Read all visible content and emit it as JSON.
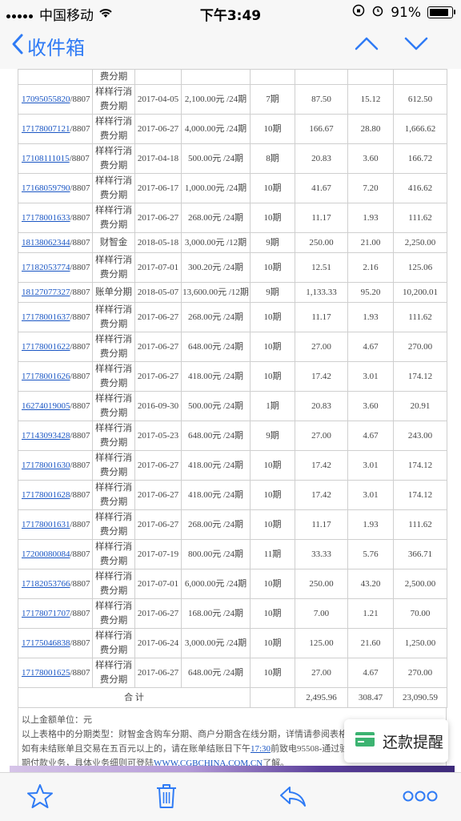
{
  "status_bar": {
    "carrier": "中国移动",
    "time": "下午3:49",
    "battery": "91%"
  },
  "nav": {
    "back_label": "收件箱"
  },
  "rows": [
    {
      "id": "17095055820",
      "suffix": "/8807",
      "type_a": "样样行消",
      "type_b": "费分期",
      "date": "2017-04-05",
      "amount": "2,100.00元 /24期",
      "period": "7期",
      "principal": "87.50",
      "fee": "15.12",
      "remaining": "612.50"
    },
    {
      "id": "17178007121",
      "suffix": "/8807",
      "type_a": "样样行消",
      "type_b": "费分期",
      "date": "2017-06-27",
      "amount": "4,000.00元 /24期",
      "period": "10期",
      "principal": "166.67",
      "fee": "28.80",
      "remaining": "1,666.62"
    },
    {
      "id": "17108111015",
      "suffix": "/8807",
      "type_a": "样样行消",
      "type_b": "费分期",
      "date": "2017-04-18",
      "amount": "500.00元 /24期",
      "period": "8期",
      "principal": "20.83",
      "fee": "3.60",
      "remaining": "166.72"
    },
    {
      "id": "17168059790",
      "suffix": "/8807",
      "type_a": "样样行消",
      "type_b": "费分期",
      "date": "2017-06-17",
      "amount": "1,000.00元 /24期",
      "period": "10期",
      "principal": "41.67",
      "fee": "7.20",
      "remaining": "416.62"
    },
    {
      "id": "17178001633",
      "suffix": "/8807",
      "type_a": "样样行消",
      "type_b": "费分期",
      "date": "2017-06-27",
      "amount": "268.00元 /24期",
      "period": "10期",
      "principal": "11.17",
      "fee": "1.93",
      "remaining": "111.62"
    },
    {
      "id": "18138062344",
      "suffix": "/8807",
      "type_a": "财智金",
      "type_b": "",
      "date": "2018-05-18",
      "amount": "3,000.00元 /12期",
      "period": "9期",
      "principal": "250.00",
      "fee": "21.00",
      "remaining": "2,250.00"
    },
    {
      "id": "17182053774",
      "suffix": "/8807",
      "type_a": "样样行消",
      "type_b": "费分期",
      "date": "2017-07-01",
      "amount": "300.20元 /24期",
      "period": "10期",
      "principal": "12.51",
      "fee": "2.16",
      "remaining": "125.06"
    },
    {
      "id": "18127077327",
      "suffix": "/8807",
      "type_a": "账单分期",
      "type_b": "",
      "date": "2018-05-07",
      "amount": "13,600.00元 /12期",
      "period": "9期",
      "principal": "1,133.33",
      "fee": "95.20",
      "remaining": "10,200.01"
    },
    {
      "id": "17178001637",
      "suffix": "/8807",
      "type_a": "样样行消",
      "type_b": "费分期",
      "date": "2017-06-27",
      "amount": "268.00元 /24期",
      "period": "10期",
      "principal": "11.17",
      "fee": "1.93",
      "remaining": "111.62"
    },
    {
      "id": "17178001622",
      "suffix": "/8807",
      "type_a": "样样行消",
      "type_b": "费分期",
      "date": "2017-06-27",
      "amount": "648.00元 /24期",
      "period": "10期",
      "principal": "27.00",
      "fee": "4.67",
      "remaining": "270.00"
    },
    {
      "id": "17178001626",
      "suffix": "/8807",
      "type_a": "样样行消",
      "type_b": "费分期",
      "date": "2017-06-27",
      "amount": "418.00元 /24期",
      "period": "10期",
      "principal": "17.42",
      "fee": "3.01",
      "remaining": "174.12"
    },
    {
      "id": "16274019005",
      "suffix": "/8807",
      "type_a": "样样行消",
      "type_b": "费分期",
      "date": "2016-09-30",
      "amount": "500.00元 /24期",
      "period": "1期",
      "principal": "20.83",
      "fee": "3.60",
      "remaining": "20.91"
    },
    {
      "id": "17143093428",
      "suffix": "/8807",
      "type_a": "样样行消",
      "type_b": "费分期",
      "date": "2017-05-23",
      "amount": "648.00元 /24期",
      "period": "9期",
      "principal": "27.00",
      "fee": "4.67",
      "remaining": "243.00"
    },
    {
      "id": "17178001630",
      "suffix": "/8807",
      "type_a": "样样行消",
      "type_b": "费分期",
      "date": "2017-06-27",
      "amount": "418.00元 /24期",
      "period": "10期",
      "principal": "17.42",
      "fee": "3.01",
      "remaining": "174.12"
    },
    {
      "id": "17178001628",
      "suffix": "/8807",
      "type_a": "样样行消",
      "type_b": "费分期",
      "date": "2017-06-27",
      "amount": "418.00元 /24期",
      "period": "10期",
      "principal": "17.42",
      "fee": "3.01",
      "remaining": "174.12"
    },
    {
      "id": "17178001631",
      "suffix": "/8807",
      "type_a": "样样行消",
      "type_b": "费分期",
      "date": "2017-06-27",
      "amount": "268.00元 /24期",
      "period": "10期",
      "principal": "11.17",
      "fee": "1.93",
      "remaining": "111.62"
    },
    {
      "id": "17200080084",
      "suffix": "/8807",
      "type_a": "样样行消",
      "type_b": "费分期",
      "date": "2017-07-19",
      "amount": "800.00元 /24期",
      "period": "11期",
      "principal": "33.33",
      "fee": "5.76",
      "remaining": "366.71"
    },
    {
      "id": "17182053766",
      "suffix": "/8807",
      "type_a": "样样行消",
      "type_b": "费分期",
      "date": "2017-07-01",
      "amount": "6,000.00元 /24期",
      "period": "10期",
      "principal": "250.00",
      "fee": "43.20",
      "remaining": "2,500.00"
    },
    {
      "id": "17178071707",
      "suffix": "/8807",
      "type_a": "样样行消",
      "type_b": "费分期",
      "date": "2017-06-27",
      "amount": "168.00元 /24期",
      "period": "10期",
      "principal": "7.00",
      "fee": "1.21",
      "remaining": "70.00"
    },
    {
      "id": "17175046838",
      "suffix": "/8807",
      "type_a": "样样行消",
      "type_b": "费分期",
      "date": "2017-06-24",
      "amount": "3,000.00元 /24期",
      "period": "10期",
      "principal": "125.00",
      "fee": "21.60",
      "remaining": "1,250.00"
    },
    {
      "id": "17178001625",
      "suffix": "/8807",
      "type_a": "样样行消",
      "type_b": "费分期",
      "date": "2017-06-27",
      "amount": "648.00元 /24期",
      "period": "10期",
      "principal": "27.00",
      "fee": "4.67",
      "remaining": "270.00"
    }
  ],
  "partial_row": {
    "type_b": "费分期"
  },
  "total": {
    "label": "合 计",
    "principal": "2,495.96",
    "fee": "308.47",
    "remaining": "23,090.59"
  },
  "notes": {
    "line1": "以上金额单位：元",
    "line2": "以上表格中的分期类型：财智金含购车分期、商户分期含在线分期，详情请参阅表格内的交易本金。",
    "line3_pre": "如有未结账单且交易在五百元以上的，请在账单结账日下午",
    "line3_link": "17:30",
    "line3_post": "前致电95508-通过验证后",
    "line4_pre": "期付款业务，具体业务细则可登陆",
    "line4_link": "WWW.CGBCHINA.COM.CN",
    "line4_post": "了解。"
  },
  "toast": {
    "label": "还款提醒"
  },
  "icons": {
    "back": "chevron-left-icon",
    "up": "chevron-up-icon",
    "down": "chevron-down-icon",
    "star": "star-icon",
    "trash": "trash-icon",
    "reply": "reply-icon",
    "more": "more-icon",
    "card": "card-icon"
  },
  "colors": {
    "accent": "#2f7bf5",
    "link": "#1a56c4",
    "toast_icon": "#3cb371"
  }
}
